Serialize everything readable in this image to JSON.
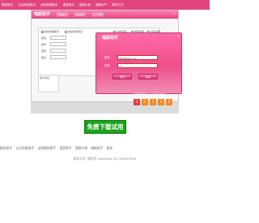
{
  "topnav": {
    "items": [
      "微信助手",
      "企业网游助手",
      "全网营销助手",
      "语音助手",
      "营销大师",
      "喵斯APP",
      "联系方式"
    ]
  },
  "app": {
    "logo": "喵斯助手",
    "tabs": [
      "营销助手",
      "语音助手",
      "天下营销"
    ],
    "close_glyph": "×",
    "options": [
      "我的营销助手",
      "发送营销消息",
      "全网营销",
      "推荐营销",
      "自动营销"
    ],
    "field_labels": [
      "昵称",
      "账号",
      "密码",
      "备注"
    ],
    "side_button": "刷新",
    "left_panel_title": "用户列表"
  },
  "dialog": {
    "logo": "喵斯助手",
    "close_glyph": "×",
    "account_label": "账号",
    "account_value": "1016@qq.com",
    "password_label": "密码",
    "password_value": "***",
    "login_label": "登录",
    "cancel_label": "取消",
    "footer": "喵斯助手版本: qq: 330843000"
  },
  "pager": {
    "pages": [
      "1",
      "2",
      "3",
      "4",
      "5"
    ],
    "active_color": "#e53d3d",
    "color": "#f28b1f"
  },
  "download": {
    "label": "免费下载试用"
  },
  "footer": {
    "links": [
      "微信助手",
      "企业网游助手",
      "全网营销助手",
      "语音助手",
      "营销大师",
      "喵斯助手",
      "联系"
    ],
    "contact": "联系方式: 微信号 xiaomiao  QQ 330843000"
  }
}
